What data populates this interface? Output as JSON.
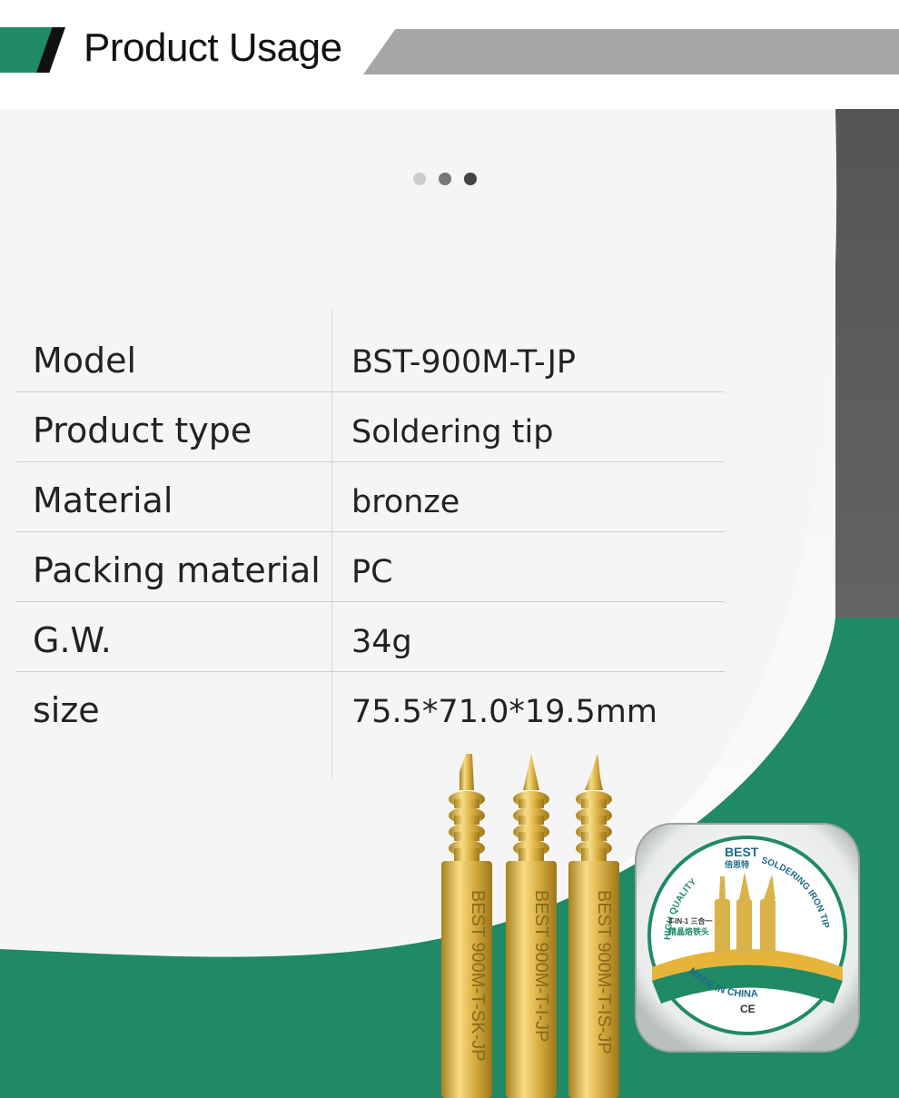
{
  "header": {
    "title": "Product Usage"
  },
  "carousel": {
    "dots": [
      {
        "color": "#cccccc"
      },
      {
        "color": "#777777"
      },
      {
        "color": "#444444"
      }
    ]
  },
  "specs": [
    {
      "label": "Model",
      "value": "BST-900M-T-JP"
    },
    {
      "label": "Product type",
      "value": "Soldering tip"
    },
    {
      "label": "Material",
      "value": "bronze"
    },
    {
      "label": "Packing material",
      "value": "PC"
    },
    {
      "label": "G.W.",
      "value": "34g"
    },
    {
      "label": "size",
      "value": "75.5*71.0*19.5mm"
    }
  ],
  "tips": [
    {
      "engraving": "BEST 900M-T-SK-JP"
    },
    {
      "engraving": "BEST 900M-T-I-JP"
    },
    {
      "engraving": "BEST 900M-T-IS-JP"
    }
  ],
  "package": {
    "brand": "BEST",
    "brand_cn": "倍思特",
    "arc_left": "HIGH QUALITY",
    "arc_right": "SOLDERING IRON TIP",
    "line1": "3-IN-1 三合一",
    "line2": "精晶烙铁头",
    "mark": "CE",
    "origin": "MADE IN CHINA"
  },
  "colors": {
    "brand_green": "#1f8a64",
    "gold": "#d9b24a"
  }
}
